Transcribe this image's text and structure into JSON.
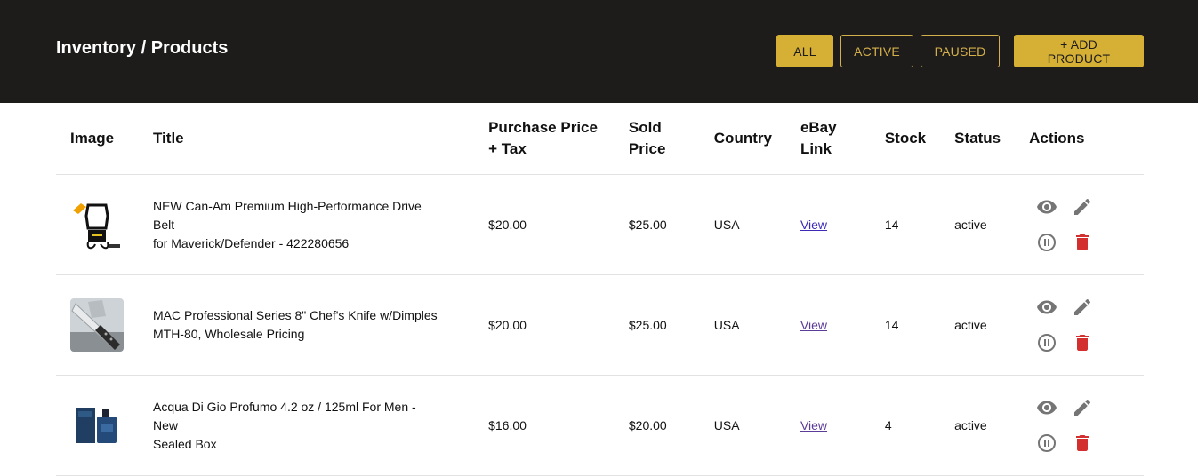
{
  "header": {
    "title": "Inventory / Products",
    "filters": [
      {
        "label": "ALL",
        "active": true
      },
      {
        "label": "ACTIVE",
        "active": false
      },
      {
        "label": "PAUSED",
        "active": false
      }
    ],
    "add_button": "+ ADD PRODUCT"
  },
  "table": {
    "columns": {
      "image": "Image",
      "title": "Title",
      "purchase_line1": "Purchase Price",
      "purchase_line2": "+ Tax",
      "sold_line1": "Sold",
      "sold_line2": "Price",
      "country": "Country",
      "ebay_line1": "eBay",
      "ebay_line2": "Link",
      "stock": "Stock",
      "status": "Status",
      "actions": "Actions"
    },
    "rows": [
      {
        "title_line1": "NEW Can-Am Premium High-Performance Drive Belt",
        "title_line2": "for Maverick/Defender - 422280656",
        "purchase_price": "$20.00",
        "sold_price": "$25.00",
        "country": "USA",
        "ebay_link": "View",
        "stock": "14",
        "status": "active"
      },
      {
        "title_line1": "MAC Professional Series 8\" Chef's Knife w/Dimples",
        "title_line2": "MTH-80, Wholesale Pricing",
        "purchase_price": "$20.00",
        "sold_price": "$25.00",
        "country": "USA",
        "ebay_link": "View",
        "stock": "14",
        "status": "active"
      },
      {
        "title_line1": "Acqua Di Gio Profumo 4.2 oz / 125ml For Men - New",
        "title_line2": "Sealed Box",
        "purchase_price": "$16.00",
        "sold_price": "$20.00",
        "country": "USA",
        "ebay_link": "View",
        "stock": "4",
        "status": "active"
      }
    ]
  },
  "colors": {
    "header_bg": "#1e1c1b",
    "accent": "#d6b035",
    "delete": "#d32f2f",
    "icon_grey": "#757575"
  },
  "icons": [
    "eye-icon",
    "pencil-icon",
    "pause-icon",
    "trash-icon"
  ]
}
